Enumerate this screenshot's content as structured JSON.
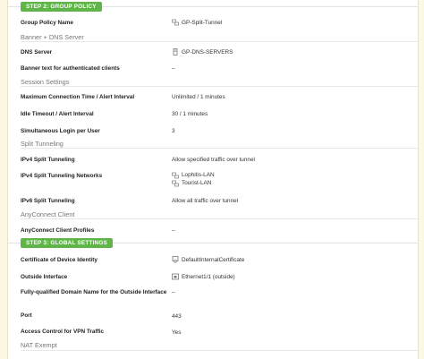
{
  "step2": {
    "badge": "STEP 2: GROUP POLICY",
    "group_policy_name": {
      "label": "Group Policy Name",
      "value": "GP-Split-Tunnel"
    },
    "banner_dns_header": "Banner + DNS Server",
    "dns_server": {
      "label": "DNS Server",
      "value": "GP-DNS-SERVERS"
    },
    "banner_text": {
      "label": "Banner text for authenticated clients",
      "value": "–"
    },
    "session_header": "Session Settings",
    "max_conn": {
      "label": "Maximum Connection Time / Alert Interval",
      "value": "Unlimited / 1 minutes"
    },
    "idle_timeout": {
      "label": "Idle Timeout / Alert Interval",
      "value": "30 / 1 minutes"
    },
    "simultaneous": {
      "label": "Simultaneous Login per User",
      "value": "3"
    },
    "split_header": "Split Tunneling",
    "ipv4_split": {
      "label": "IPv4 Split Tunneling",
      "value": "Allow specified traffic over tunnel"
    },
    "ipv4_networks": {
      "label": "IPv4 Split Tunneling Networks",
      "values": [
        "Lophitis-LAN",
        "Tourist-LAN"
      ]
    },
    "ipv6_split": {
      "label": "IPv6 Split Tunneling",
      "value": "Allow all traffic over tunnel"
    },
    "anyconnect_header": "AnyConnect Client",
    "anyconnect_profiles": {
      "label": "AnyConnect Client Profiles",
      "value": "–"
    }
  },
  "step3": {
    "badge": "STEP 3: GLOBAL SETTINGS",
    "cert": {
      "label": "Certificate of Device Identity",
      "value": "DefaultInternalCertificate"
    },
    "outside_if": {
      "label": "Outside Interface",
      "value": "Ethernet1/1 (outside)"
    },
    "fqdn": {
      "label": "Fully-qualified Domain Name for the Outside Interface",
      "value": "–"
    },
    "port": {
      "label": "Port",
      "value": "443"
    },
    "access_control": {
      "label": "Access Control for VPN Traffic",
      "value": "Yes"
    },
    "nat_header": "NAT Exempt"
  },
  "colors": {
    "badge": "#5fb548",
    "page_bg": "#fdf8e3"
  }
}
